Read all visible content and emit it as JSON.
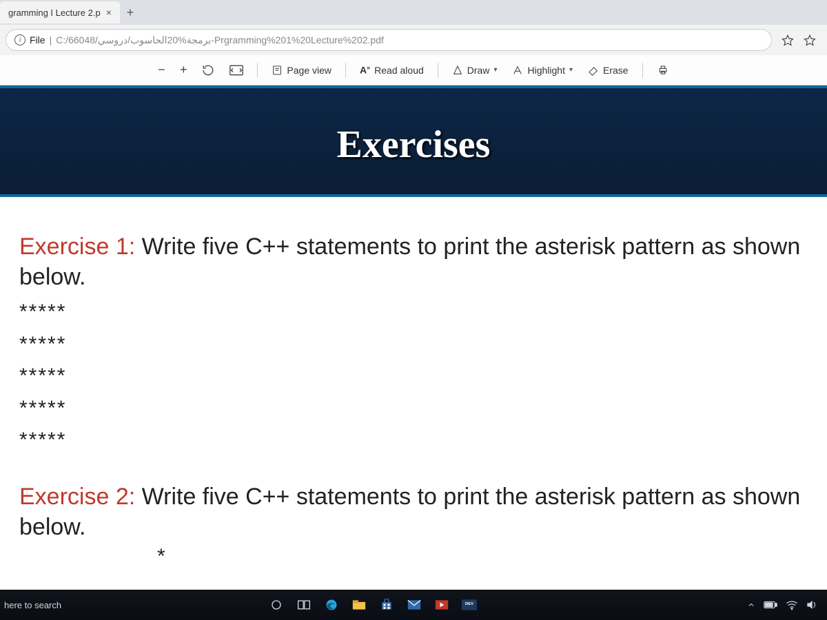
{
  "browser": {
    "tab_title": "gramming I Lecture 2.p",
    "address": {
      "scheme": "File",
      "path": "C:/66048/برمجة%20الحاسوب/دروسي-Prgramming%201%20Lecture%202.pdf"
    }
  },
  "toolbar": {
    "page_view": "Page view",
    "read_aloud": "Read aloud",
    "draw": "Draw",
    "highlight": "Highlight",
    "erase": "Erase"
  },
  "document": {
    "banner_title": "Exercises",
    "exercises": [
      {
        "label": "Exercise 1:",
        "prompt": "Write five C++ statements to print the asterisk pattern as shown below.",
        "pattern": [
          "*****",
          "*****",
          "*****",
          "*****",
          "*****"
        ]
      },
      {
        "label": "Exercise 2:",
        "prompt": "Write five C++ statements to print the asterisk pattern as shown below.",
        "pattern_partial": "*"
      }
    ]
  },
  "taskbar": {
    "search_placeholder": "here to search",
    "app_labels": [
      "cortana",
      "task-view",
      "edge",
      "file-explorer",
      "store",
      "mail",
      "media",
      "dev"
    ]
  },
  "colors": {
    "banner_bg": "#0d2746",
    "accent": "#0c6a9e",
    "exercise_label": "#c0392b"
  }
}
